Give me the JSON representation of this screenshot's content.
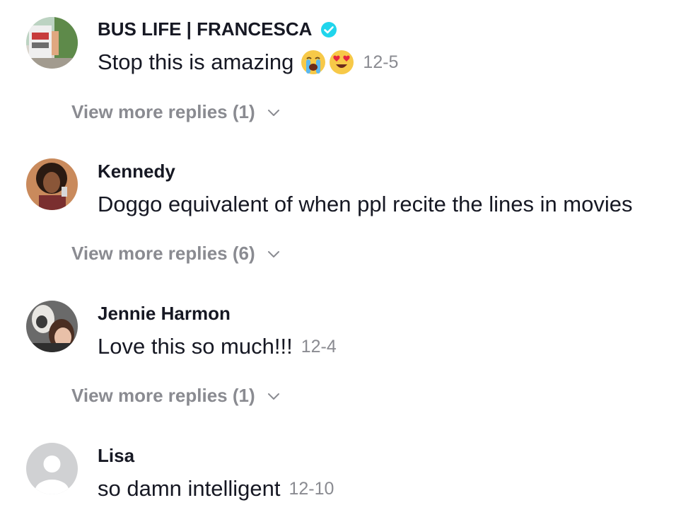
{
  "comments": [
    {
      "username": "BUS LIFE | FRANCESCA",
      "verified": true,
      "text": "Stop this is amazing",
      "emojis": [
        "loudly-crying-face-icon",
        "heart-eyes-icon"
      ],
      "date": "12-5",
      "replies_label": "View more replies (1)"
    },
    {
      "username": "Kennedy",
      "text": "Doggo equivalent of when ppl recite the lines in movies",
      "replies_label": "View more replies (6)"
    },
    {
      "username": "Jennie Harmon",
      "text": "Love this so much!!!",
      "date": "12-4",
      "replies_label": "View more replies (1)"
    },
    {
      "username": "Lisa",
      "text": "so damn intelligent",
      "date": "12-10"
    }
  ],
  "colors": {
    "text_primary": "#161823",
    "text_secondary": "#8a8b91",
    "verified_blue": "#20d5ec"
  }
}
